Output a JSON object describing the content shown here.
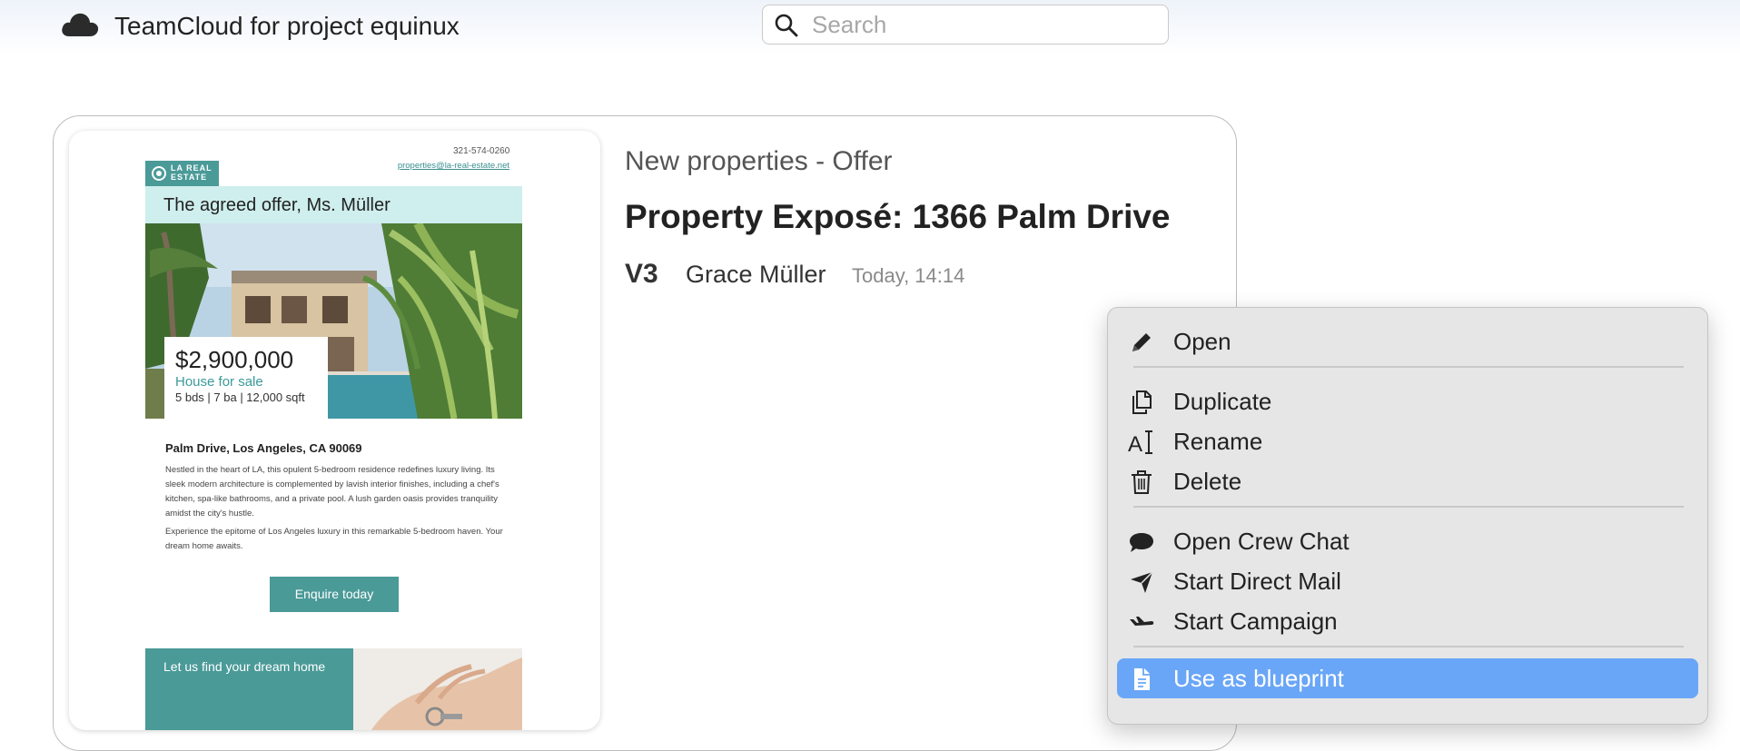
{
  "app": {
    "title": "TeamCloud for project equinux",
    "logo_icon": "cloud-icon"
  },
  "search": {
    "placeholder": "Search",
    "value": "",
    "icon": "search-icon"
  },
  "document": {
    "type": "New properties - Offer",
    "title": "Property Exposé: 1366 Palm Drive",
    "version": "V3",
    "author": "Grace Müller",
    "modified": "Today, 14:14"
  },
  "thumbnail": {
    "phone": "321-574-0260",
    "email": "properties@la-real-estate.net",
    "logo_text": "LA REAL ESTATE",
    "headline": "The agreed offer, Ms. Müller",
    "price": "$2,900,000",
    "status": "House for sale",
    "specs": "5 bds  |  7 ba  |  12,000 sqft",
    "address": "Palm Drive, Los Angeles, CA 90069",
    "description": "Nestled in the heart of LA, this opulent 5-bedroom residence redefines luxury living. Its sleek modern architecture is complemented by lavish interior finishes, including a chef's kitchen, spa-like bathrooms, and a private pool. A lush garden oasis provides tranquility amidst the city's hustle.",
    "description2": "Experience the epitome of Los Angeles luxury in this remarkable 5-bedroom haven. Your dream home awaits.",
    "cta": "Enquire today",
    "footer_text": "Let us find your dream home",
    "brand_color": "#4a9a98",
    "banner_color": "#cfeeee"
  },
  "context_menu": {
    "items": [
      {
        "label": "Open",
        "icon": "pencil-icon"
      },
      {
        "label": "Duplicate",
        "icon": "duplicate-icon"
      },
      {
        "label": "Rename",
        "icon": "rename-icon"
      },
      {
        "label": "Delete",
        "icon": "trash-icon"
      },
      {
        "label": "Open Crew Chat",
        "icon": "chat-bubble-icon"
      },
      {
        "label": "Start Direct Mail",
        "icon": "paper-plane-icon"
      },
      {
        "label": "Start Campaign",
        "icon": "airplane-icon"
      },
      {
        "label": "Use as blueprint",
        "icon": "document-icon",
        "highlighted": true
      }
    ],
    "highlight_color": "#6aa6f7"
  }
}
